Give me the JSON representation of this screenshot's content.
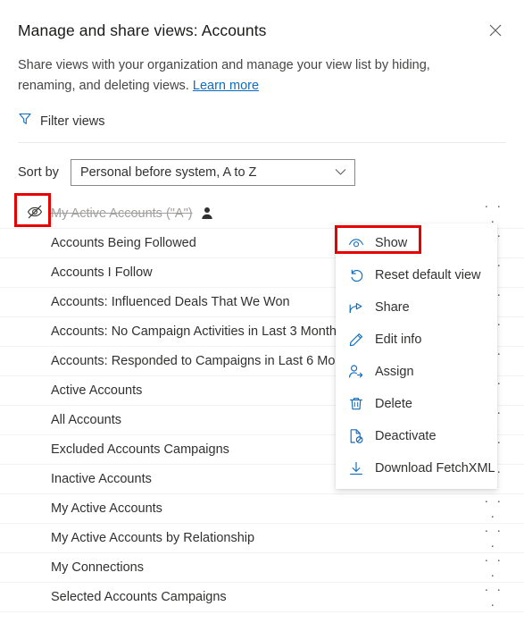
{
  "header": {
    "title": "Manage and share views: Accounts",
    "close_icon": "close-icon",
    "subtitle_text": "Share views with your organization and manage your view list by hiding, renaming, and deleting views.",
    "learn_more_label": "Learn more"
  },
  "filter": {
    "label": "Filter views",
    "icon": "filter-funnel-icon"
  },
  "sort": {
    "label": "Sort by",
    "value": "Personal before system, A to Z",
    "chevron_icon": "chevron-down-icon"
  },
  "list": {
    "overflow_glyph": "· · ·",
    "rows": [
      {
        "name": "My Active Accounts (\"A\")",
        "hidden": true,
        "lead_icon": "eye-hidden-icon",
        "owner_icon": "person-icon",
        "has_overflow": true
      },
      {
        "name": "Accounts Being Followed",
        "hidden": false,
        "lead_icon": "",
        "owner_icon": "",
        "has_overflow": true
      },
      {
        "name": "Accounts I Follow",
        "hidden": false,
        "lead_icon": "",
        "owner_icon": "",
        "has_overflow": true
      },
      {
        "name": "Accounts: Influenced Deals That We Won",
        "hidden": false,
        "lead_icon": "",
        "owner_icon": "",
        "has_overflow": true
      },
      {
        "name": "Accounts: No Campaign Activities in Last 3 Months",
        "hidden": false,
        "lead_icon": "",
        "owner_icon": "",
        "has_overflow": true
      },
      {
        "name": "Accounts: Responded to Campaigns in Last 6 Months",
        "hidden": false,
        "lead_icon": "",
        "owner_icon": "",
        "has_overflow": true
      },
      {
        "name": "Active Accounts",
        "hidden": false,
        "lead_icon": "",
        "owner_icon": "",
        "has_overflow": true
      },
      {
        "name": "All Accounts",
        "hidden": false,
        "lead_icon": "",
        "owner_icon": "",
        "has_overflow": true
      },
      {
        "name": "Excluded Accounts Campaigns",
        "hidden": false,
        "lead_icon": "",
        "owner_icon": "",
        "has_overflow": true
      },
      {
        "name": "Inactive Accounts",
        "hidden": false,
        "lead_icon": "",
        "owner_icon": "",
        "has_overflow": true
      },
      {
        "name": "My Active Accounts",
        "hidden": false,
        "lead_icon": "",
        "owner_icon": "",
        "has_overflow": true
      },
      {
        "name": "My Active Accounts by Relationship",
        "hidden": false,
        "lead_icon": "",
        "owner_icon": "",
        "has_overflow": true
      },
      {
        "name": "My Connections",
        "hidden": false,
        "lead_icon": "",
        "owner_icon": "",
        "has_overflow": true
      },
      {
        "name": "Selected Accounts Campaigns",
        "hidden": false,
        "lead_icon": "",
        "owner_icon": "",
        "has_overflow": true
      }
    ]
  },
  "context_menu": {
    "items": [
      {
        "label": "Show",
        "icon": "eye-show-icon"
      },
      {
        "label": "Reset default view",
        "icon": "undo-arrow-icon"
      },
      {
        "label": "Share",
        "icon": "share-icon"
      },
      {
        "label": "Edit info",
        "icon": "pencil-edit-icon"
      },
      {
        "label": "Assign",
        "icon": "person-assign-icon"
      },
      {
        "label": "Delete",
        "icon": "trash-icon"
      },
      {
        "label": "Deactivate",
        "icon": "deactivate-document-icon"
      },
      {
        "label": "Download FetchXML",
        "icon": "download-arrow-icon"
      }
    ]
  },
  "annotations": {
    "eye_toggle_highlight_color": "#e60000",
    "show_menu_highlight_color": "#e60000"
  },
  "colors": {
    "accent": "#0f6cbd",
    "link": "#0f6cbd",
    "text": "#323130",
    "muted_text": "#a19f9d",
    "divider": "#edebe9",
    "row_divider": "#f3f2f1",
    "highlight_red": "#e60000"
  }
}
